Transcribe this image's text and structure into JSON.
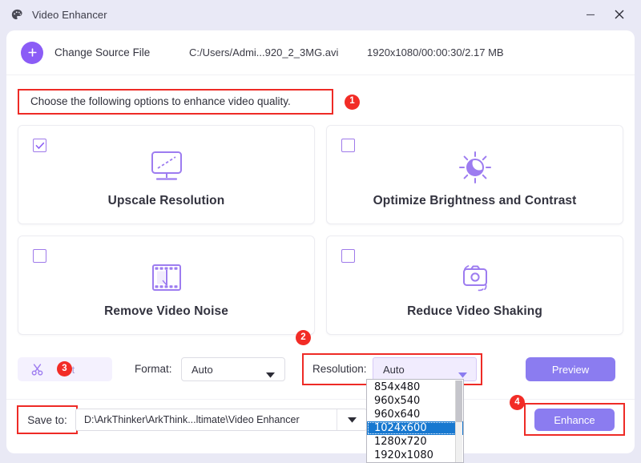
{
  "window": {
    "title": "Video Enhancer",
    "app_icon": "palette-icon",
    "minimize_label": "—",
    "close_label": "×",
    "accent_color": "#8b7cf0",
    "badge_color": "#f22c26",
    "highlight_border_color": "#ee2b26"
  },
  "source": {
    "add_icon": "plus-icon",
    "change_label": "Change Source File",
    "path": "C:/Users/Admi...920_2_3MG.avi",
    "meta": "1920x1080/00:00:30/2.17 MB"
  },
  "hint": {
    "text": "Choose the following options to enhance video quality.",
    "badge": "1"
  },
  "options": [
    {
      "label": "Upscale Resolution",
      "checked": true,
      "icon": "monitor-upscale-icon"
    },
    {
      "label": "Optimize Brightness and Contrast",
      "checked": false,
      "icon": "sun-brightness-icon"
    },
    {
      "label": "Remove Video Noise",
      "checked": false,
      "icon": "film-strip-icon"
    },
    {
      "label": "Reduce Video Shaking",
      "checked": false,
      "icon": "camera-stabilize-icon"
    }
  ],
  "controls": {
    "cut_label": "Cut",
    "cut_icon": "scissors-icon",
    "format_label": "Format:",
    "format_value": "Auto",
    "resolution_label": "Resolution:",
    "resolution_value": "Auto",
    "resolution_badge": "2",
    "preview_label": "Preview",
    "dropdown_icon": "chevron-down-icon"
  },
  "resolution_dropdown": {
    "open": true,
    "options": [
      "854x480",
      "960x540",
      "960x640",
      "1024x600",
      "1280x720",
      "1920x1080"
    ],
    "selected": "1024x600",
    "selected_index": 3
  },
  "save": {
    "label": "Save to:",
    "badge": "3",
    "path": "D:\\ArkThinker\\ArkThink...ltimate\\Video Enhancer",
    "dropdown_icon": "chevron-down-icon",
    "enhance_label": "Enhance",
    "enhance_badge": "4"
  }
}
